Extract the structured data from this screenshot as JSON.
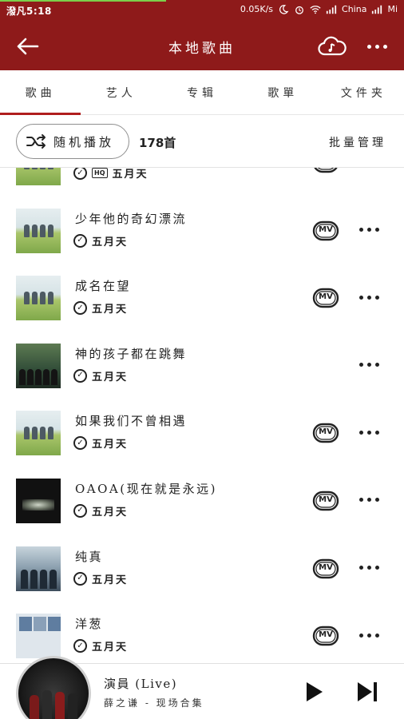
{
  "status_bar": {
    "left_text": "潑凡5:18",
    "speed": "0.05K/s",
    "carrier": "China",
    "extra": "Mi"
  },
  "header": {
    "title": "本地歌曲",
    "back_icon": "arrow-left-icon",
    "cloud_icon": "cloud-music-icon",
    "more_icon": "more-dots-icon"
  },
  "tabs": [
    {
      "label": "歌曲",
      "active": true
    },
    {
      "label": "艺人",
      "active": false
    },
    {
      "label": "专辑",
      "active": false
    },
    {
      "label": "歌單",
      "active": false
    },
    {
      "label": "文件夹",
      "active": false
    }
  ],
  "action_bar": {
    "shuffle_label": "随机播放",
    "count": "178首",
    "batch_label": "批量管理"
  },
  "songs": [
    {
      "title": "妈妈(想把你写成一首歌)",
      "artist": "五月天",
      "hq": "HQ",
      "mv": true,
      "cover": "field"
    },
    {
      "title": "少年他的奇幻漂流",
      "artist": "五月天",
      "mv": true,
      "cover": "field"
    },
    {
      "title": "成名在望",
      "artist": "五月天",
      "mv": true,
      "cover": "field"
    },
    {
      "title": "神的孩子都在跳舞",
      "artist": "五月天",
      "mv": false,
      "cover": "forest"
    },
    {
      "title": "如果我们不曾相遇",
      "artist": "五月天",
      "mv": true,
      "cover": "field"
    },
    {
      "title": "OAOA(现在就是永远)",
      "artist": "五月天",
      "mv": true,
      "cover": "dark"
    },
    {
      "title": "纯真",
      "artist": "五月天",
      "mv": true,
      "cover": "band"
    },
    {
      "title": "洋葱",
      "artist": "五月天",
      "mv": true,
      "cover": "onion"
    }
  ],
  "mv_label": "MV",
  "player": {
    "title": "演員 (Live)",
    "subtitle": "薛之谦 - 现场合集"
  },
  "colors": {
    "brand": "#8e1a1a",
    "tab_indicator": "#b01e1e"
  }
}
